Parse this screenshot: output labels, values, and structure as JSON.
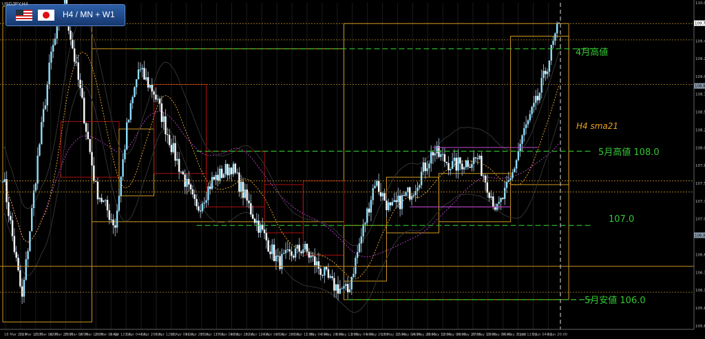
{
  "window": {
    "symbol_label": "USDJPY,H4",
    "title": "H4 / MN + W1"
  },
  "annotations": {
    "april_high": "4月高値",
    "sma_label": "H4 sma21",
    "may_high": "5月高値 108.0",
    "level_107": "107.0",
    "may_low": "5月安値 106.0"
  },
  "colors": {
    "background": "#000000",
    "bull": "#8fe0ff",
    "bear": "#ffffff",
    "annotation_green": "#32c832",
    "sma_label": "#e8a020",
    "monthly_box": "#d09a20",
    "weekly_box": "#b01010",
    "sma_line": "#e0a030",
    "purple": "#b040c0",
    "grid": "#2a2a2a"
  },
  "icons": [
    "us-flag-icon",
    "japan-flag-icon"
  ],
  "chart_data": {
    "type": "candlestick",
    "title": "H4 / MN + W1",
    "ylim": [
      105.6,
      110.0
    ],
    "price_ticks": [
      "110.000",
      "109.720",
      "109.484",
      "109.248",
      "109.008",
      "108.768",
      "108.528",
      "108.288",
      "108.048",
      "107.808",
      "107.568",
      "107.328",
      "107.088",
      "106.848",
      "106.608",
      "106.368",
      "106.128",
      "105.888",
      "105.648"
    ],
    "time_ticks": [
      "18 Mar 2019",
      "19 Mar 12:00",
      "21 Mar 04:00",
      "22 Mar 20:00",
      "25 Mar 04:00",
      "27 Mar 12:00",
      "29 Mar 04:00",
      "1 Apr 12:00",
      "3 Apr 04:00",
      "4 Apr 20:00",
      "8 Apr 12:00",
      "10 Apr 04:00",
      "11 Apr 20:00",
      "15 Apr 12:00",
      "17 Apr 04:00",
      "18 Apr 20:00",
      "22 Apr 12:00",
      "24 Apr 04:00",
      "25 Apr 20:00",
      "29 Apr 12:00",
      "1 May 04:00",
      "2 May 20:00",
      "6 May 12:00",
      "8 May 04:00",
      "9 May 20:00",
      "13 May 12:00",
      "15 May 04:00",
      "16 May 20:00",
      "20 May 12:00",
      "22 May 04:00",
      "23 May 20:00",
      "27 May 12:00",
      "29 May 04:00",
      "30 May 20:00",
      "3 Jun 12:00",
      "5 Jun 04:00",
      "6 Jun 20:00"
    ],
    "current_price": "109.725",
    "highlight_ticks": [
      "108.880",
      "106.868"
    ],
    "anchors": [
      {
        "i": 0,
        "p": 107.7
      },
      {
        "i": 10,
        "p": 106.0
      },
      {
        "i": 18,
        "p": 107.9
      },
      {
        "i": 25,
        "p": 109.3
      },
      {
        "i": 32,
        "p": 110.0
      },
      {
        "i": 40,
        "p": 108.8
      },
      {
        "i": 48,
        "p": 107.5
      },
      {
        "i": 58,
        "p": 107.0
      },
      {
        "i": 64,
        "p": 108.3
      },
      {
        "i": 70,
        "p": 109.1
      },
      {
        "i": 78,
        "p": 108.8
      },
      {
        "i": 88,
        "p": 108.0
      },
      {
        "i": 100,
        "p": 107.2
      },
      {
        "i": 108,
        "p": 107.6
      },
      {
        "i": 118,
        "p": 107.8
      },
      {
        "i": 128,
        "p": 107.2
      },
      {
        "i": 142,
        "p": 106.5
      },
      {
        "i": 155,
        "p": 106.7
      },
      {
        "i": 170,
        "p": 106.2
      },
      {
        "i": 178,
        "p": 106.1
      },
      {
        "i": 192,
        "p": 107.6
      },
      {
        "i": 200,
        "p": 107.2
      },
      {
        "i": 212,
        "p": 107.5
      },
      {
        "i": 222,
        "p": 108.0
      },
      {
        "i": 232,
        "p": 107.8
      },
      {
        "i": 245,
        "p": 107.9
      },
      {
        "i": 255,
        "p": 107.2
      },
      {
        "i": 262,
        "p": 107.6
      },
      {
        "i": 268,
        "p": 108.2
      },
      {
        "i": 276,
        "p": 108.7
      },
      {
        "i": 287,
        "p": 109.72
      }
    ],
    "levels": [
      {
        "name": "april-high",
        "price": 109.38
      },
      {
        "name": "may-high",
        "price": 108.0
      },
      {
        "name": "level-107",
        "price": 107.0
      },
      {
        "name": "may-low",
        "price": 106.0
      }
    ]
  }
}
